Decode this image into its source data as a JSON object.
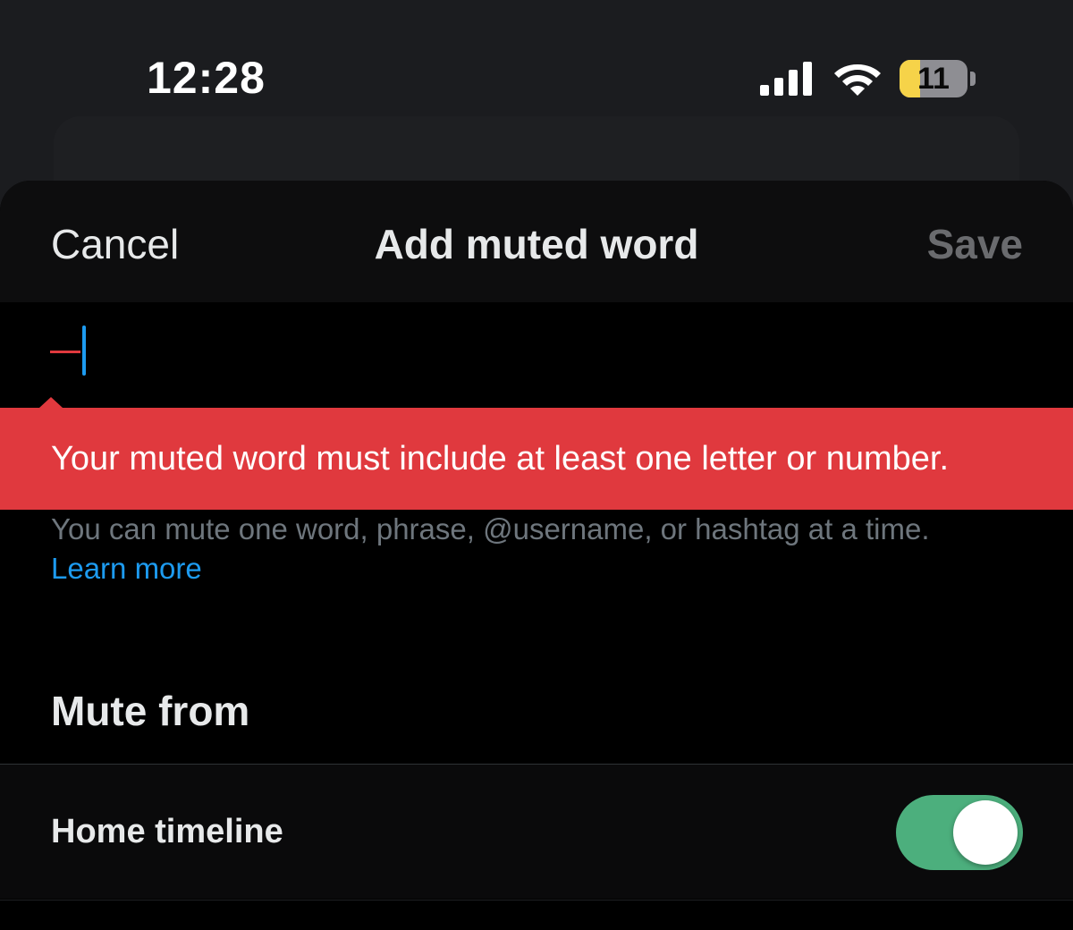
{
  "status_bar": {
    "time": "12:28",
    "battery_level": "11",
    "battery_fraction": 0.3,
    "icons": [
      "signal-icon",
      "wifi-icon",
      "battery-icon"
    ]
  },
  "nav": {
    "cancel_label": "Cancel",
    "title": "Add muted word",
    "save_label": "Save"
  },
  "input": {
    "value": ""
  },
  "error": {
    "message": "Your muted word must include at least one letter or number."
  },
  "helper": {
    "text": "You can mute one word, phrase, @username, or hashtag at a time.",
    "link_label": "Learn more"
  },
  "mute_from": {
    "title": "Mute from",
    "options": [
      {
        "label": "Home timeline",
        "enabled": true
      }
    ]
  },
  "colors": {
    "error": "#e0393e",
    "link": "#1d9bf0",
    "toggle_on": "#4caf7d",
    "battery_low": "#f6d349"
  }
}
